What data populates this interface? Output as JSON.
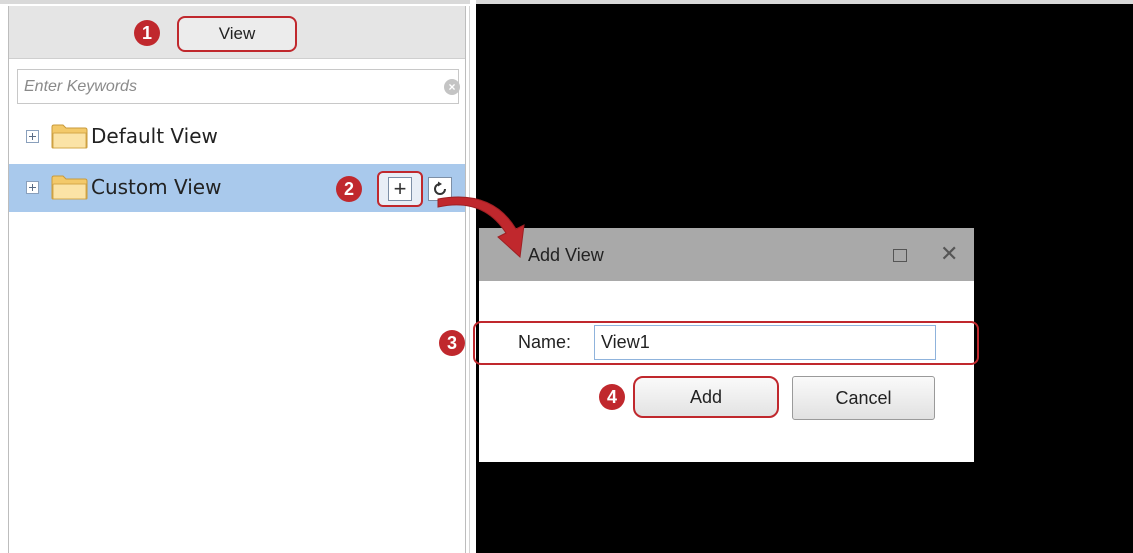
{
  "panel": {
    "tab_label": "View",
    "search_placeholder": "Enter Keywords",
    "tree": [
      {
        "label": "Default View"
      },
      {
        "label": "Custom View"
      }
    ],
    "add_button_symbol": "+"
  },
  "steps": [
    "1",
    "2",
    "3",
    "4"
  ],
  "dialog": {
    "title": "Add View",
    "name_label": "Name:",
    "name_value": "View1",
    "add_label": "Add",
    "cancel_label": "Cancel"
  },
  "colors": {
    "accent_red": "#c0282d",
    "selected_row": "#a9c9ec",
    "titlebar_gray": "#a9a9a9"
  },
  "icons": [
    "clear-icon",
    "expand-icon",
    "folder-icon",
    "add-icon",
    "refresh-icon",
    "maximize-icon",
    "close-icon",
    "arrow-icon"
  ]
}
